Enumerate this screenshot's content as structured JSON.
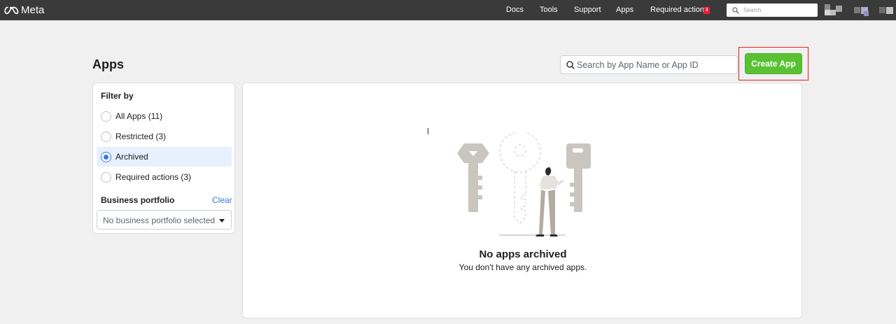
{
  "topbar": {
    "logo_text": "Meta",
    "nav": [
      "Docs",
      "Tools",
      "Support",
      "Apps",
      "Required actions"
    ],
    "required_actions_count": "3",
    "search_placeholder": "Search"
  },
  "page": {
    "title": "Apps",
    "search_placeholder": "Search by App Name or App ID",
    "create_button": "Create App"
  },
  "filter": {
    "heading": "Filter by",
    "options": [
      {
        "label": "All Apps (11)",
        "selected": false
      },
      {
        "label": "Restricted (3)",
        "selected": false
      },
      {
        "label": "Archived",
        "selected": true
      },
      {
        "label": "Required actions (3)",
        "selected": false
      }
    ],
    "business_heading": "Business portfolio",
    "clear_label": "Clear",
    "business_value": "No business portfolio selected"
  },
  "empty_state": {
    "title": "No apps archived",
    "subtitle": "You don't have any archived apps."
  },
  "colors": {
    "topbar": "#3a3a3a",
    "create_button": "#5ac232",
    "accent": "#3578e5",
    "highlight": "#e02020",
    "badge": "#e41e3f"
  },
  "icons": [
    "meta-logo-icon",
    "search-icon",
    "key-icon",
    "chevron-down-icon"
  ]
}
